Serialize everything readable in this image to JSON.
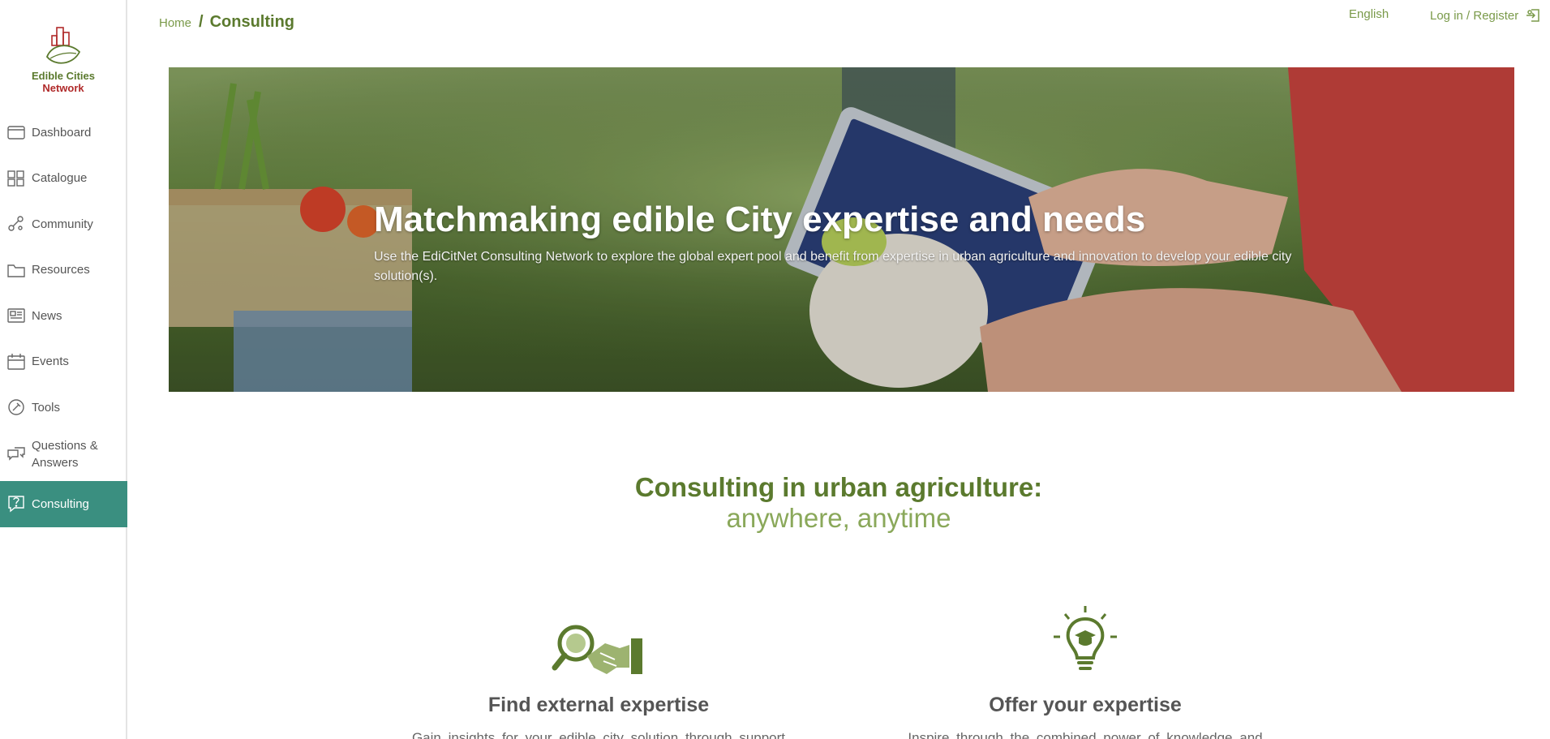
{
  "sidebar": {
    "logo_line1": "Edible Cities",
    "logo_line2": "Network",
    "items": [
      {
        "label": "Dashboard",
        "icon": "dashboard-icon"
      },
      {
        "label": "Catalogue",
        "icon": "catalogue-icon"
      },
      {
        "label": "Community",
        "icon": "community-icon"
      },
      {
        "label": "Resources",
        "icon": "folder-icon"
      },
      {
        "label": "News",
        "icon": "news-icon"
      },
      {
        "label": "Events",
        "icon": "calendar-icon"
      },
      {
        "label": "Tools",
        "icon": "tools-icon"
      },
      {
        "label": "Questions & Answers",
        "icon": "chat-icon"
      },
      {
        "label": "Consulting",
        "icon": "consulting-icon",
        "active": true
      }
    ]
  },
  "header": {
    "breadcrumb_home": "Home",
    "breadcrumb_sep": "/",
    "breadcrumb_current": "Consulting",
    "language": "English",
    "login": "Log in / Register"
  },
  "hero": {
    "title": "Matchmaking edible City expertise and needs",
    "subtitle": "Use the EdiCitNet Consulting Network to explore the global expert pool and benefit from expertise in urban agriculture and innovation to develop your edible city solution(s)."
  },
  "section": {
    "title": "Consulting in urban agriculture:",
    "subtitle": "anywhere, anytime"
  },
  "cards": [
    {
      "title": "Find external expertise",
      "text": "Gain insights for your edible city solution through support",
      "icon": "magnifier-handshake-icon"
    },
    {
      "title": "Offer your expertise",
      "text": "Inspire through the combined power of knowledge and",
      "icon": "lightbulb-graduate-icon"
    }
  ],
  "colors": {
    "accent_green": "#5b7a2e",
    "light_green": "#8aa85a",
    "active_teal": "#3a8f80",
    "logo_red": "#b02a2a"
  }
}
